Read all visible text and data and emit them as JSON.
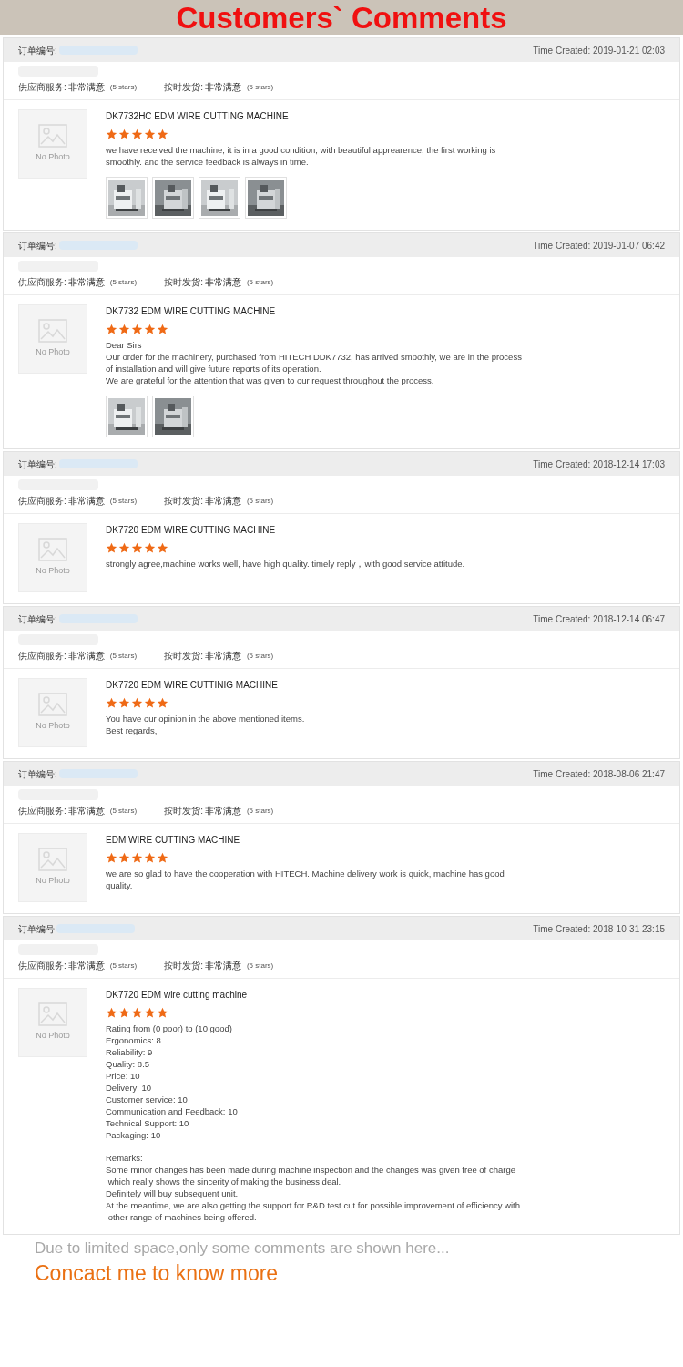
{
  "title": "Customers` Comments",
  "reviews": [
    {
      "order_label": "订单编号:",
      "time": "Time Created: 2019-01-21 02:03",
      "ratings": [
        {
          "label": "供应商服务:",
          "value": "非常满意",
          "note": "(5 stars)"
        },
        {
          "label": "按时发货:",
          "value": "非常满意",
          "note": "(5 stars)"
        }
      ],
      "thumb_text": "No Photo",
      "product": "DK7732HC EDM WIRE CUTTING MACHINE",
      "stars": 5,
      "comment": [
        [
          "we have received the machine, it is in a good condition, with beautiful apprearence, the first working is",
          "smoothly. and the service feedback is always in time."
        ]
      ],
      "photos": [
        {
          "kind": "picture"
        },
        {
          "kind": "picture"
        },
        {
          "kind": "picture"
        },
        {
          "kind": "picture"
        }
      ]
    },
    {
      "order_label": "订单编号:",
      "time": "Time Created: 2019-01-07 06:42",
      "ratings": [
        {
          "label": "供应商服务:",
          "value": "非常满意",
          "note": "(5 stars)"
        },
        {
          "label": "按时发货:",
          "value": "非常满意",
          "note": "(5 stars)"
        }
      ],
      "thumb_text": "No Photo",
      "product": "DK7732 EDM WIRE CUTTING MACHINE",
      "stars": 5,
      "comment": [
        [
          "Dear Sirs",
          "Our order for the machinery, purchased from HITECH DDK7732, has arrived smoothly, we are in the process",
          "of installation and will give future reports of its operation.",
          "We are grateful for the attention that was given to our request throughout the process."
        ]
      ],
      "photos": [
        {
          "kind": "picture"
        },
        {
          "kind": "picture"
        }
      ]
    },
    {
      "order_label": "订单编号:",
      "time": "Time Created: 2018-12-14 17:03",
      "ratings": [
        {
          "label": "供应商服务:",
          "value": "非常满意",
          "note": "(5 stars)"
        },
        {
          "label": "按时发货:",
          "value": "非常满意",
          "note": "(5 stars)"
        }
      ],
      "thumb_text": "No Photo",
      "product": "DK7720 EDM WIRE CUTTING MACHINE",
      "stars": 5,
      "comment": [
        [
          "strongly agree,machine works well, have high quality. timely reply，with good service attitude."
        ]
      ]
    },
    {
      "order_label": "订单编号:",
      "time": "Time Created: 2018-12-14 06:47",
      "ratings": [
        {
          "label": "供应商服务:",
          "value": "非常满意",
          "note": "(5 stars)"
        },
        {
          "label": "按时发货:",
          "value": "非常满意",
          "note": "(5 stars)"
        }
      ],
      "thumb_text": "No Photo",
      "product": "DK7720 EDM WIRE CUTTINIG MACHINE",
      "stars": 5,
      "comment": [
        [
          "You have our opinion in the above mentioned items.",
          "Best regards,"
        ]
      ]
    },
    {
      "order_label": "订单编号:",
      "time": "Time Created: 2018-08-06 21:47",
      "ratings": [
        {
          "label": "供应商服务:",
          "value": "非常满意",
          "note": "(5 stars)"
        },
        {
          "label": "按时发货:",
          "value": "非常满意",
          "note": "(5 stars)"
        }
      ],
      "thumb_text": "No Photo",
      "product": "EDM WIRE CUTTING MACHINE",
      "stars": 5,
      "comment": [
        [
          "we are so glad to have the cooperation with HITECH. Machine delivery work is quick, machine has good",
          "quality."
        ]
      ]
    },
    {
      "order_label": "订单编号",
      "time": "Time Created: 2018-10-31 23:15",
      "ratings": [
        {
          "label": "供应商服务:",
          "value": "非常满意",
          "note": "(5 stars)"
        },
        {
          "label": "按时发货:",
          "value": "非常满意",
          "note": "(5 stars)"
        }
      ],
      "thumb_text": "No Photo",
      "product": "DK7720 EDM wire cutting machine",
      "stars": 5,
      "comment": [
        [
          "Rating from (0 poor) to (10 good)",
          "Ergonomics: 8",
          "Reliability: 9",
          "Quality: 8.5",
          "Price: 10",
          "Delivery: 10",
          "Customer service: 10",
          "Communication and Feedback: 10",
          "Technical Support: 10",
          "Packaging: 10"
        ],
        [
          "Remarks:",
          "Some minor changes has been made during machine inspection and the changes was given free of charge",
          " which really shows the sincerity of making the business deal.",
          "Definitely will buy subsequent unit.",
          "At the meantime, we are also getting the support for R&D test cut for possible improvement of efficiency with",
          " other range of machines being offered."
        ]
      ]
    }
  ],
  "footer": {
    "note": "Due to limited space,only some comments are shown here...",
    "cta": "Concact me to know more"
  }
}
